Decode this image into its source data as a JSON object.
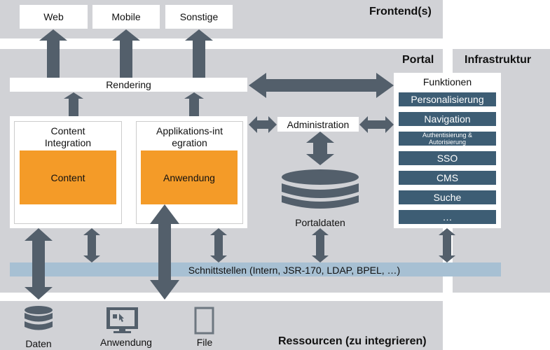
{
  "frontend": {
    "title": "Frontend(s)",
    "items": [
      "Web",
      "Mobile",
      "Sonstige"
    ]
  },
  "portal": {
    "title": "Portal",
    "rendering": "Rendering",
    "content_integration": {
      "title": "Content Integration",
      "inner": "Content"
    },
    "app_integration": {
      "title": "Applikations-integration",
      "inner": "Anwendung"
    },
    "administration": "Administration",
    "portaldaten": "Portaldaten",
    "schnittstellen": "Schnittstellen (Intern, JSR-170, LDAP, BPEL, …)"
  },
  "infrastruktur": {
    "title": "Infrastruktur"
  },
  "funktionen": {
    "title": "Funktionen",
    "items": [
      "Personalisierung",
      "Navigation",
      "Authentisierung & Autorisierung",
      "SSO",
      "CMS",
      "Suche",
      "…"
    ]
  },
  "ressourcen": {
    "title": "Ressourcen (zu integrieren)",
    "items": [
      {
        "label": "Daten",
        "icon": "database-icon"
      },
      {
        "label": "Anwendung",
        "icon": "monitor-icon"
      },
      {
        "label": "File",
        "icon": "file-icon"
      }
    ]
  },
  "colors": {
    "band": "#d1d2d6",
    "arrow": "#535f6b",
    "orange": "#f49b28",
    "function": "#3d5d74",
    "interface": "#a7c0d3"
  }
}
